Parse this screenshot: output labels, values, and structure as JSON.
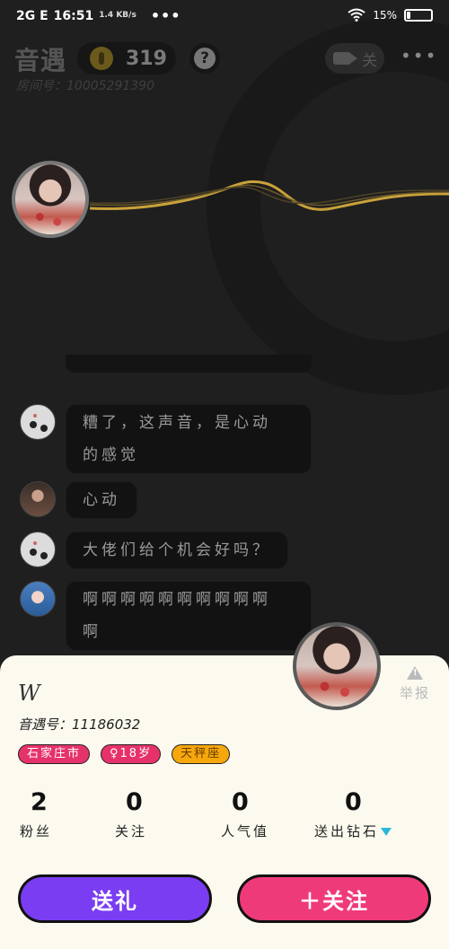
{
  "status_bar": {
    "network": "2G E",
    "time": "16:51",
    "speed": "1.4 KB/s",
    "dots": "•••",
    "battery": "15%",
    "battery_level": 0.15
  },
  "header": {
    "title": "音遇",
    "coins": "319",
    "help": "?",
    "room_id": "房间号：10005291390",
    "camera_toggle": "关",
    "more": "•••"
  },
  "chat": {
    "messages": [
      {
        "text": "糟了，这声音，是心动\n的感觉",
        "avatar": "dots-avatar"
      },
      {
        "text": "心动",
        "avatar": "dark-avatar"
      },
      {
        "text": "大佬们给个机会好吗？",
        "avatar": "dots-avatar"
      },
      {
        "text": "啊啊啊啊啊啊啊啊啊啊\n啊",
        "avatar": "anime-avatar"
      }
    ]
  },
  "profile": {
    "username": "W",
    "yuyu_id": "音遇号：11186032",
    "report": "举报",
    "tags": {
      "city": "石家庄市",
      "age": "♀18岁",
      "zodiac": "天秤座"
    },
    "stats": [
      {
        "value": "2",
        "label": "粉丝"
      },
      {
        "value": "0",
        "label": "关注"
      },
      {
        "value": "0",
        "label": "人气值"
      },
      {
        "value": "0",
        "label": "送出钻石"
      }
    ],
    "gift_button": "送礼",
    "follow_button": "＋关注"
  },
  "colors": {
    "accent_purple": "#7a3df2",
    "accent_pink": "#ef3a7a",
    "wave_gold": "#c9a23a",
    "card_bg": "#fcf9ee"
  }
}
